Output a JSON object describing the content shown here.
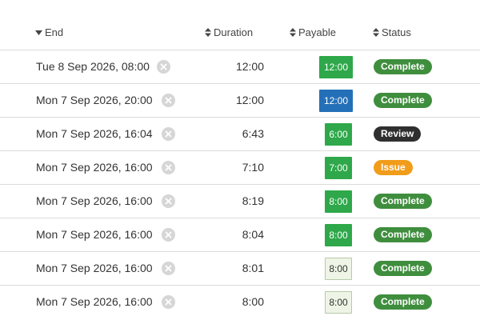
{
  "columns": {
    "end": "End",
    "duration": "Duration",
    "payable": "Payable",
    "status": "Status"
  },
  "icons": {
    "sort_desc": "caret-down-icon",
    "sort_both": "sort-icon",
    "clear": "close-circle-icon"
  },
  "colors": {
    "complete": "#3f8e3e",
    "review": "#2f2f2f",
    "issue": "#f19c1a",
    "pay_green": "#2ea84a",
    "pay_blue": "#2470b8",
    "pay_light": "#eef5e6"
  },
  "rows": [
    {
      "end": "Tue 8 Sep 2026, 08:00",
      "duration": "12:00",
      "payable": "12:00",
      "payable_style": "green",
      "status": "Complete",
      "status_kind": "complete"
    },
    {
      "end": "Mon 7 Sep 2026, 20:00",
      "duration": "12:00",
      "payable": "12:00",
      "payable_style": "blue",
      "status": "Complete",
      "status_kind": "complete"
    },
    {
      "end": "Mon 7 Sep 2026, 16:04",
      "duration": "6:43",
      "payable": "6:00",
      "payable_style": "green",
      "status": "Review",
      "status_kind": "review"
    },
    {
      "end": "Mon 7 Sep 2026, 16:00",
      "duration": "7:10",
      "payable": "7:00",
      "payable_style": "green",
      "status": "Issue",
      "status_kind": "issue"
    },
    {
      "end": "Mon 7 Sep 2026, 16:00",
      "duration": "8:19",
      "payable": "8:00",
      "payable_style": "green",
      "status": "Complete",
      "status_kind": "complete"
    },
    {
      "end": "Mon 7 Sep 2026, 16:00",
      "duration": "8:04",
      "payable": "8:00",
      "payable_style": "green",
      "status": "Complete",
      "status_kind": "complete"
    },
    {
      "end": "Mon 7 Sep 2026, 16:00",
      "duration": "8:01",
      "payable": "8:00",
      "payable_style": "light",
      "status": "Complete",
      "status_kind": "complete"
    },
    {
      "end": "Mon 7 Sep 2026, 16:00",
      "duration": "8:00",
      "payable": "8:00",
      "payable_style": "light",
      "status": "Complete",
      "status_kind": "complete"
    }
  ]
}
